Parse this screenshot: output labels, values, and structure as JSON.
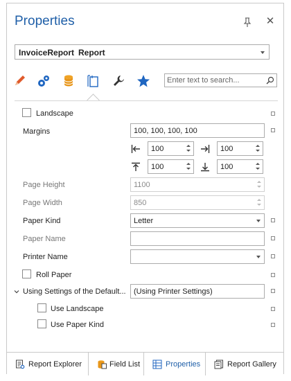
{
  "panel": {
    "title": "Properties"
  },
  "object_selector": {
    "name": "InvoiceReport",
    "type": "Report"
  },
  "tabs": [
    {
      "icon": "pencil-icon"
    },
    {
      "icon": "gears-icon"
    },
    {
      "icon": "database-icon"
    },
    {
      "icon": "page-layout-icon",
      "active": true
    },
    {
      "icon": "wrench-icon"
    },
    {
      "icon": "star-icon"
    }
  ],
  "search": {
    "placeholder": "Enter text to search..."
  },
  "properties": {
    "landscape": {
      "label": "Landscape",
      "checked": false
    },
    "margins": {
      "label": "Margins",
      "value": "100, 100, 100, 100",
      "left": "100",
      "right": "100",
      "top": "100",
      "bottom": "100"
    },
    "page_height": {
      "label": "Page Height",
      "value": "1100"
    },
    "page_width": {
      "label": "Page Width",
      "value": "850"
    },
    "paper_kind": {
      "label": "Paper Kind",
      "value": "Letter"
    },
    "paper_name": {
      "label": "Paper Name",
      "value": ""
    },
    "printer_name": {
      "label": "Printer Name",
      "value": ""
    },
    "roll_paper": {
      "label": "Roll Paper",
      "checked": false
    },
    "using_settings": {
      "label": "Using Settings of the Default...",
      "value": "(Using Printer Settings)"
    },
    "use_landscape": {
      "label": "Use Landscape",
      "checked": false
    },
    "use_paper_kind": {
      "label": "Use Paper Kind",
      "checked": false
    }
  },
  "bottom_tabs": [
    {
      "label": "Report Explorer",
      "icon": "report-explorer-icon"
    },
    {
      "label": "Field List",
      "icon": "field-list-icon"
    },
    {
      "label": "Properties",
      "icon": "properties-grid-icon",
      "active": true
    },
    {
      "label": "Report Gallery",
      "icon": "report-gallery-icon"
    }
  ],
  "colors": {
    "accent": "#1f5fa8",
    "border": "#c9c9c9"
  }
}
